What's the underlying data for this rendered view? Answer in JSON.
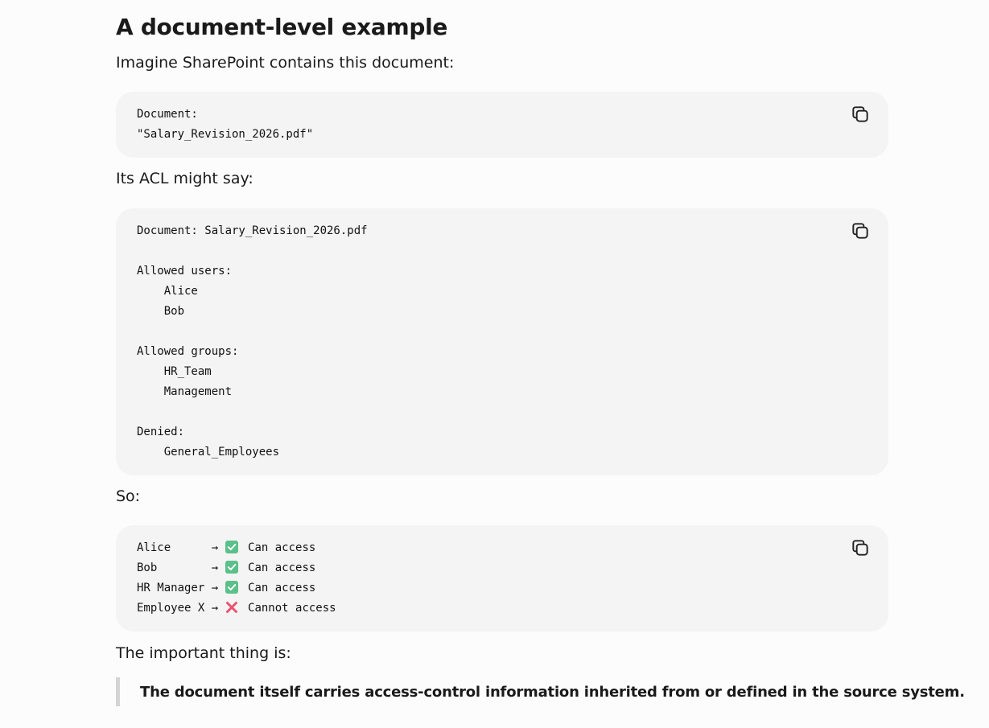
{
  "heading": "A document-level example",
  "intro": "Imagine SharePoint contains this document:",
  "block1": {
    "lines": [
      "Document:",
      "\"Salary_Revision_2026.pdf\""
    ],
    "copy_icon": "copy-icon"
  },
  "acl_intro": "Its ACL might say:",
  "block2": {
    "lines": [
      "Document: Salary_Revision_2026.pdf",
      "",
      "Allowed users:",
      "    Alice",
      "    Bob",
      "",
      "Allowed groups:",
      "    HR_Team",
      "    Management",
      "",
      "Denied:",
      "    General_Employees"
    ],
    "copy_icon": "copy-icon"
  },
  "so": "So:",
  "block3": {
    "arrow": "→",
    "rows": [
      {
        "name": "Alice      ",
        "status": "Can access",
        "allowed": true
      },
      {
        "name": "Bob        ",
        "status": "Can access",
        "allowed": true
      },
      {
        "name": "HR Manager ",
        "status": "Can access",
        "allowed": true
      },
      {
        "name": "Employee X ",
        "status": "Cannot access",
        "allowed": false
      }
    ],
    "copy_icon": "copy-icon"
  },
  "important": "The important thing is:",
  "quote": "The document itself carries access-control information inherited from or defined in the source system.",
  "colors": {
    "check_green": "#5bc08a",
    "cross_red": "#e8546f",
    "code_bg": "#f4f4f4"
  }
}
